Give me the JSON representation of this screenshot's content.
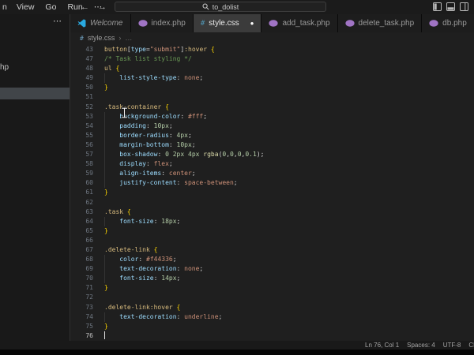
{
  "titlebar": {
    "menu_items": [
      "n",
      "View",
      "Go",
      "Run",
      "⋯"
    ],
    "back_glyph": "←",
    "forward_glyph": "→",
    "search": {
      "text": "to_dolist"
    }
  },
  "tabs": [
    {
      "label": "Welcome",
      "icon": "vscode",
      "italic": true,
      "active": false,
      "modified": false
    },
    {
      "label": "index.php",
      "icon": "php",
      "active": false,
      "modified": false
    },
    {
      "label": "style.css",
      "icon": "css",
      "active": true,
      "modified": true
    },
    {
      "label": "add_task.php",
      "icon": "php",
      "active": false,
      "modified": false
    },
    {
      "label": "delete_task.php",
      "icon": "php",
      "active": false,
      "modified": false
    },
    {
      "label": "db.php",
      "icon": "php",
      "active": false,
      "modified": false
    }
  ],
  "modified_dot_glyph": "●",
  "breadcrumb": {
    "icon_glyph": "#",
    "file": "style.css",
    "sep": "›",
    "more": "…"
  },
  "sidebar": {
    "more_glyph": "⋯",
    "partial_item": "hp"
  },
  "editor": {
    "cursor_line": 76,
    "lines": [
      {
        "n": 43,
        "t": [
          [
            "button",
            "sel"
          ],
          [
            "[",
            "pun"
          ],
          [
            "type",
            "attr"
          ],
          [
            "=",
            "pun"
          ],
          [
            "\"submit\"",
            "str"
          ],
          [
            "]",
            "pun"
          ],
          [
            ":hover",
            "sel"
          ],
          [
            " ",
            "pln"
          ],
          [
            "{",
            "brk"
          ]
        ]
      },
      {
        "n": 47,
        "t": [
          [
            "/* Task list styling */",
            "com"
          ]
        ]
      },
      {
        "n": 48,
        "t": [
          [
            "ul",
            "sel"
          ],
          [
            " ",
            "pln"
          ],
          [
            "{",
            "brk"
          ]
        ]
      },
      {
        "n": 49,
        "t": [
          [
            "    ",
            "pln"
          ],
          [
            "list-style-type",
            "prop"
          ],
          [
            ": ",
            "pun"
          ],
          [
            "none",
            "val"
          ],
          [
            ";",
            "pun"
          ]
        ]
      },
      {
        "n": 50,
        "t": [
          [
            "}",
            "brk"
          ]
        ]
      },
      {
        "n": 51,
        "t": []
      },
      {
        "n": 52,
        "t": [
          [
            ".task-container",
            "sel"
          ],
          [
            " ",
            "pln"
          ],
          [
            "{",
            "brk"
          ]
        ]
      },
      {
        "n": 53,
        "t": [
          [
            "    ",
            "pln"
          ],
          [
            "background-color",
            "prop"
          ],
          [
            ": ",
            "pun"
          ],
          [
            "#fff",
            "val"
          ],
          [
            ";",
            "pun"
          ]
        ]
      },
      {
        "n": 54,
        "t": [
          [
            "    ",
            "pln"
          ],
          [
            "padding",
            "prop"
          ],
          [
            ": ",
            "pun"
          ],
          [
            "10px",
            "num"
          ],
          [
            ";",
            "pun"
          ]
        ]
      },
      {
        "n": 55,
        "t": [
          [
            "    ",
            "pln"
          ],
          [
            "border-radius",
            "prop"
          ],
          [
            ": ",
            "pun"
          ],
          [
            "4px",
            "num"
          ],
          [
            ";",
            "pun"
          ]
        ]
      },
      {
        "n": 56,
        "t": [
          [
            "    ",
            "pln"
          ],
          [
            "margin-bottom",
            "prop"
          ],
          [
            ": ",
            "pun"
          ],
          [
            "10px",
            "num"
          ],
          [
            ";",
            "pun"
          ]
        ]
      },
      {
        "n": 57,
        "t": [
          [
            "    ",
            "pln"
          ],
          [
            "box-shadow",
            "prop"
          ],
          [
            ": ",
            "pun"
          ],
          [
            "0",
            "num"
          ],
          [
            " ",
            "pln"
          ],
          [
            "2px",
            "num"
          ],
          [
            " ",
            "pln"
          ],
          [
            "4px",
            "num"
          ],
          [
            " ",
            "pln"
          ],
          [
            "rgba",
            "fn"
          ],
          [
            "(",
            "pun"
          ],
          [
            "0",
            "num"
          ],
          [
            ",",
            "pun"
          ],
          [
            "0",
            "num"
          ],
          [
            ",",
            "pun"
          ],
          [
            "0",
            "num"
          ],
          [
            ",",
            "pun"
          ],
          [
            "0.1",
            "num"
          ],
          [
            ")",
            "pun"
          ],
          [
            ";",
            "pun"
          ]
        ]
      },
      {
        "n": 58,
        "t": [
          [
            "    ",
            "pln"
          ],
          [
            "display",
            "prop"
          ],
          [
            ": ",
            "pun"
          ],
          [
            "flex",
            "val"
          ],
          [
            ";",
            "pun"
          ]
        ]
      },
      {
        "n": 59,
        "t": [
          [
            "    ",
            "pln"
          ],
          [
            "align-items",
            "prop"
          ],
          [
            ": ",
            "pun"
          ],
          [
            "center",
            "val"
          ],
          [
            ";",
            "pun"
          ]
        ]
      },
      {
        "n": 60,
        "t": [
          [
            "    ",
            "pln"
          ],
          [
            "justify-content",
            "prop"
          ],
          [
            ": ",
            "pun"
          ],
          [
            "space-between",
            "val"
          ],
          [
            ";",
            "pun"
          ]
        ]
      },
      {
        "n": 61,
        "t": [
          [
            "}",
            "brk"
          ]
        ]
      },
      {
        "n": 62,
        "t": []
      },
      {
        "n": 63,
        "t": [
          [
            ".task",
            "sel"
          ],
          [
            " ",
            "pln"
          ],
          [
            "{",
            "brk"
          ]
        ]
      },
      {
        "n": 64,
        "t": [
          [
            "    ",
            "pln"
          ],
          [
            "font-size",
            "prop"
          ],
          [
            ": ",
            "pun"
          ],
          [
            "18px",
            "num"
          ],
          [
            ";",
            "pun"
          ]
        ]
      },
      {
        "n": 65,
        "t": [
          [
            "}",
            "brk"
          ]
        ]
      },
      {
        "n": 66,
        "t": []
      },
      {
        "n": 67,
        "t": [
          [
            ".delete-link",
            "sel"
          ],
          [
            " ",
            "pln"
          ],
          [
            "{",
            "brk"
          ]
        ]
      },
      {
        "n": 68,
        "t": [
          [
            "    ",
            "pln"
          ],
          [
            "color",
            "prop"
          ],
          [
            ": ",
            "pun"
          ],
          [
            "#f44336",
            "val"
          ],
          [
            ";",
            "pun"
          ]
        ]
      },
      {
        "n": 69,
        "t": [
          [
            "    ",
            "pln"
          ],
          [
            "text-decoration",
            "prop"
          ],
          [
            ": ",
            "pun"
          ],
          [
            "none",
            "val"
          ],
          [
            ";",
            "pun"
          ]
        ]
      },
      {
        "n": 70,
        "t": [
          [
            "    ",
            "pln"
          ],
          [
            "font-size",
            "prop"
          ],
          [
            ": ",
            "pun"
          ],
          [
            "14px",
            "num"
          ],
          [
            ";",
            "pun"
          ]
        ]
      },
      {
        "n": 71,
        "t": [
          [
            "}",
            "brk"
          ]
        ]
      },
      {
        "n": 72,
        "t": []
      },
      {
        "n": 73,
        "t": [
          [
            ".delete-link:hover",
            "sel"
          ],
          [
            " ",
            "pln"
          ],
          [
            "{",
            "brk"
          ]
        ]
      },
      {
        "n": 74,
        "t": [
          [
            "    ",
            "pln"
          ],
          [
            "text-decoration",
            "prop"
          ],
          [
            ": ",
            "pun"
          ],
          [
            "underline",
            "val"
          ],
          [
            ";",
            "pun"
          ]
        ]
      },
      {
        "n": 75,
        "t": [
          [
            "}",
            "brk"
          ]
        ]
      },
      {
        "n": 76,
        "t": []
      }
    ]
  },
  "statusbar": {
    "items": [
      "Ln 76, Col 1",
      "Spaces: 4",
      "UTF-8",
      "CRLF"
    ]
  },
  "colors": {
    "sel": "#d7ba7d",
    "prop": "#9cdcfe",
    "val": "#ce9178",
    "num": "#b5cea8",
    "com": "#6a9955",
    "pun": "#d4d4d4",
    "brk": "#ffd700",
    "fn": "#dcdcaa",
    "str": "#ce9178",
    "attr": "#9cdcfe",
    "pln": "#d4d4d4",
    "php_icon": "#a074c4",
    "css_icon": "#519aba",
    "vscode_icon": "#29a9e0",
    "editor_bg": "#1f1f1f",
    "active_tab_bg": "#3b3b3b"
  }
}
